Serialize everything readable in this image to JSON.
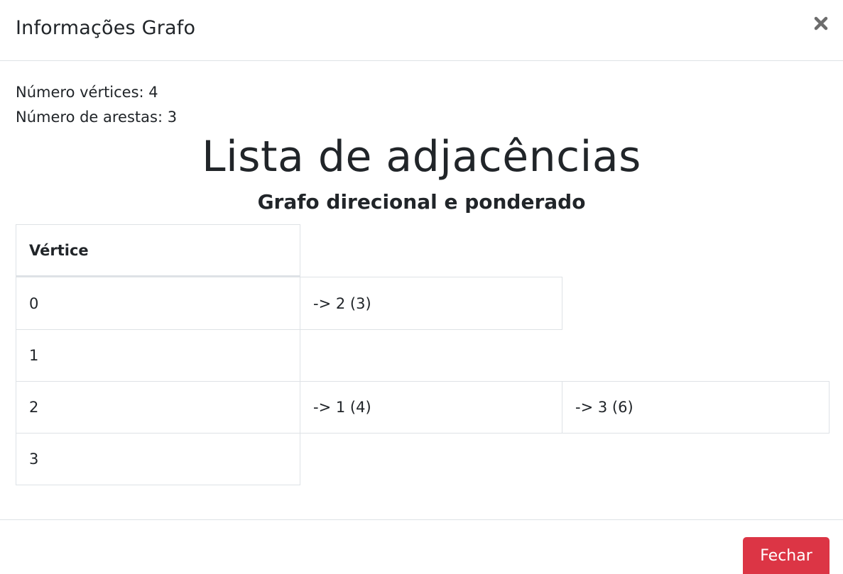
{
  "modal": {
    "title": "Informações Grafo",
    "close_icon": "close-icon"
  },
  "info": {
    "vertices": "Número vértices: 4",
    "edges": "Número de arestas: 3"
  },
  "adjacency": {
    "title": "Lista de adjacências",
    "subtitle": "Grafo direcional e ponderado",
    "header": "Vértice",
    "rows": [
      {
        "vertex": "0",
        "edges": [
          "-> 2 (3)"
        ]
      },
      {
        "vertex": "1",
        "edges": []
      },
      {
        "vertex": "2",
        "edges": [
          "-> 1 (4)",
          "-> 3 (6)"
        ]
      },
      {
        "vertex": "3",
        "edges": []
      }
    ]
  },
  "footer": {
    "close_label": "Fechar",
    "close_color": "#dc3545"
  }
}
